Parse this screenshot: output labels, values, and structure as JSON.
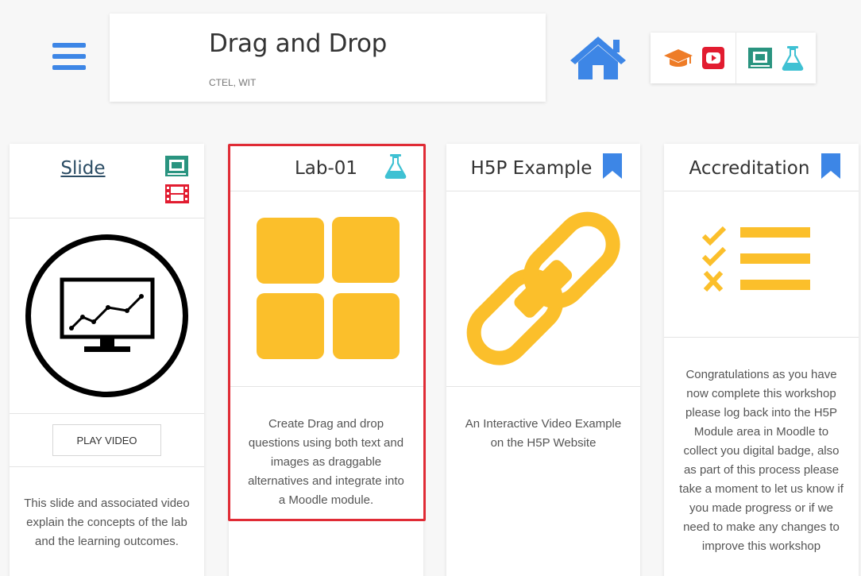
{
  "header": {
    "title": "Drag and Drop",
    "subtitle": "CTEL, WIT"
  },
  "nav": {
    "menu_icon": "hamburger-menu-icon",
    "home_icon": "home-icon",
    "toolbar_icons": [
      "graduation-cap-icon",
      "youtube-icon",
      "frame-icon",
      "flask-icon"
    ]
  },
  "colors": {
    "blue": "#3d86e6",
    "yellow": "#fbbf2b",
    "teal": "#2a9480",
    "cyan": "#3fc1d3",
    "red": "#e21c30",
    "orange": "#ee7c27",
    "highlight_border": "#e02b35"
  },
  "cards": [
    {
      "title": "Slide",
      "icons": [
        "frame-icon",
        "film-icon"
      ],
      "image": "monitor-chart-icon",
      "button": "PLAY VIDEO",
      "description": "This slide and associated video explain the concepts of the lab and the learning outcomes."
    },
    {
      "title": "Lab-01",
      "icons": [
        "flask-icon"
      ],
      "image": "four-squares-icon",
      "description": "Create Drag and drop questions using both text and images as draggable alternatives and integrate into a Moodle module."
    },
    {
      "title": "H5P Example",
      "icons": [
        "bookmark-icon"
      ],
      "image": "link-icon",
      "description": "An Interactive Video Example on the H5P Website"
    },
    {
      "title": "Accreditation",
      "icons": [
        "bookmark-icon"
      ],
      "image": "checklist-icon",
      "description": "Congratulations as you have now complete this workshop please log back into the H5P Module area in Moodle to collect you digital badge, also as part of this process please take a moment to let us know if you made progress or if we need to make any changes to improve this workshop"
    }
  ]
}
